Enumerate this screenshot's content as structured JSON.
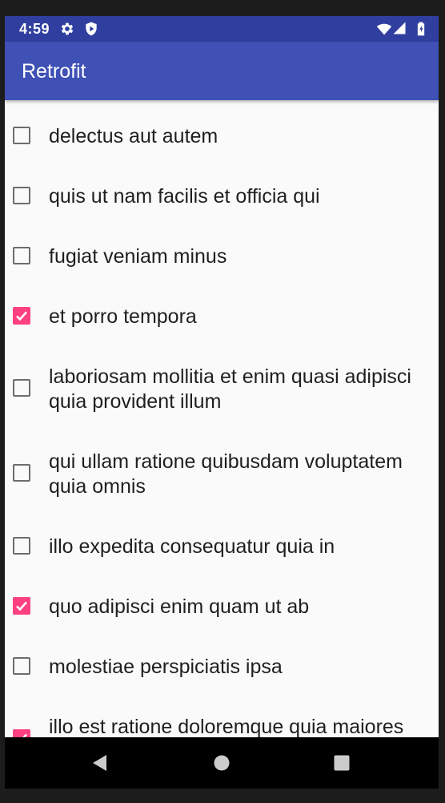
{
  "status_bar": {
    "time": "4:59",
    "icons": [
      "gear-icon",
      "shield-icon",
      "wifi-icon",
      "signal-icon",
      "battery-icon"
    ]
  },
  "app_bar": {
    "title": "Retrofit",
    "color": "#3f51b5",
    "status_color": "#303f9f"
  },
  "accent_color": "#ff4081",
  "items": [
    {
      "label": "delectus aut autem",
      "checked": false
    },
    {
      "label": "quis ut nam facilis et officia qui",
      "checked": false
    },
    {
      "label": "fugiat veniam minus",
      "checked": false
    },
    {
      "label": "et porro tempora",
      "checked": true
    },
    {
      "label": "laboriosam mollitia et enim quasi adipisci quia provident illum",
      "checked": false
    },
    {
      "label": "qui ullam ratione quibusdam voluptatem quia omnis",
      "checked": false
    },
    {
      "label": "illo expedita consequatur quia in",
      "checked": false
    },
    {
      "label": "quo adipisci enim quam ut ab",
      "checked": true
    },
    {
      "label": "molestiae perspiciatis ipsa",
      "checked": false
    },
    {
      "label": "illo est ratione doloremque quia maiores",
      "checked": true
    }
  ],
  "nav_bar": {
    "buttons": [
      "back-icon",
      "home-icon",
      "recents-icon"
    ]
  }
}
